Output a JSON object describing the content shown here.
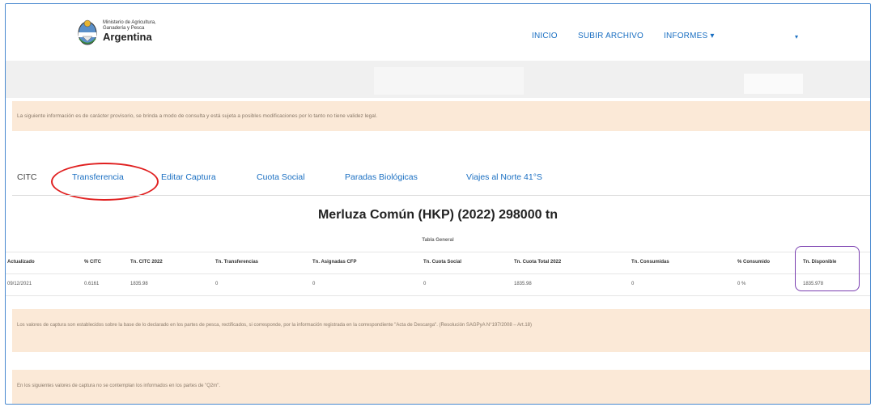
{
  "header": {
    "ministry_line1": "Ministerio de Agricultura,",
    "ministry_line2": "Ganadería y Pesca",
    "country": "Argentina",
    "nav": {
      "inicio": "INICIO",
      "subir_archivo": "SUBIR ARCHIVO",
      "informes": "INFORMES ▾",
      "user_menu": "▾"
    }
  },
  "notice_top": "La siguiente información es de carácter provisorio, se brinda a modo de consulta y está sujeta a posibles modificaciones por lo tanto no tiene validez legal.",
  "tabs": [
    {
      "label": "CITC",
      "active": true
    },
    {
      "label": "Transferencia",
      "active": false
    },
    {
      "label": "Editar Captura",
      "active": false
    },
    {
      "label": "Cuota Social",
      "active": false
    },
    {
      "label": "Paradas Biológicas",
      "active": false
    },
    {
      "label": "Viajes al Norte 41°S",
      "active": false
    }
  ],
  "page_title": "Merluza Común (HKP) (2022) 298000 tn",
  "table": {
    "caption": "Tabla General",
    "headers": [
      "Actualizado",
      "% CITC",
      "Tn. CITC 2022",
      "Tn. Transferencias",
      "Tn. Asignadas CFP",
      "Tn. Cuota Social",
      "Tn. Cuota Total 2022",
      "Tn. Consumidas",
      "% Consumido",
      "Tn. Disponible"
    ],
    "rows": [
      [
        "09/12/2021",
        "0.6161",
        "1835.98",
        "0",
        "0",
        "0",
        "1835.98",
        "0",
        "0 %",
        "1835.978"
      ]
    ]
  },
  "notice_capture": "Los valores de captura son establecidos sobre la base de lo declarado en los partes de pesca, rectificados, si corresponde, por la información registrada en la correspondiente \"Acta de Descarga\". (Resolución SAGPyA N°197/2008 – Art.18)",
  "notice_bottom": "En los siguientes valores de captura no se contemplan los informados en los partes de \"Q2m\".",
  "colors": {
    "accent": "#1a6fc2",
    "notice_bg": "#fbe9d7",
    "annotation_red": "#e02020",
    "annotation_purple": "#7a3fb0"
  }
}
